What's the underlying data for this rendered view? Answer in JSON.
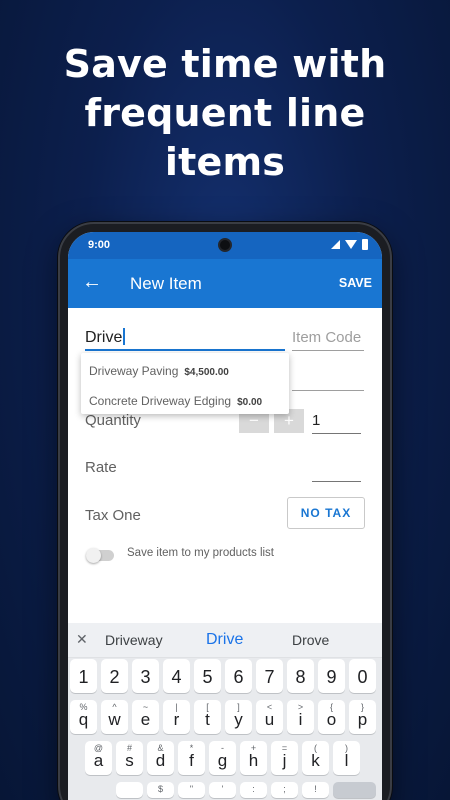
{
  "headline": "Save time with frequent line items",
  "status_bar": {
    "time": "9:00"
  },
  "app_bar": {
    "title": "New Item",
    "save_label": "SAVE",
    "back_icon": "arrow-left-icon"
  },
  "form": {
    "item_name_value": "Drive",
    "item_code_placeholder": "Item Code",
    "suggestions": [
      {
        "name": "Driveway Paving",
        "price": "$4,500.00"
      },
      {
        "name": "Concrete Driveway Edging",
        "price": "$0.00"
      }
    ],
    "quantity_label": "Quantity",
    "quantity_value": "1",
    "minus_label": "−",
    "plus_label": "+",
    "rate_label": "Rate",
    "tax_label": "Tax One",
    "tax_button_label": "NO TAX",
    "save_toggle_label": "Save item to my products list"
  },
  "keyboard": {
    "suggestions": [
      "Driveway",
      "Drive",
      "Drove"
    ],
    "number_row": [
      "1",
      "2",
      "3",
      "4",
      "5",
      "6",
      "7",
      "8",
      "9",
      "0"
    ],
    "row1": {
      "keys": [
        "q",
        "w",
        "e",
        "r",
        "t",
        "y",
        "u",
        "i",
        "o",
        "p"
      ],
      "alts": [
        "%",
        "^",
        "~",
        "|",
        "[",
        "]",
        "<",
        ">",
        "{",
        "}"
      ]
    },
    "row2": {
      "keys": [
        "a",
        "s",
        "d",
        "f",
        "g",
        "h",
        "j",
        "k",
        "l"
      ],
      "alts": [
        "@",
        "#",
        "&",
        "*",
        "-",
        "+",
        "=",
        "(",
        ")"
      ]
    },
    "row3_alts": [
      "$",
      "\"",
      "'",
      ":",
      ";",
      "!"
    ]
  },
  "colors": {
    "primary": "#1976d2",
    "status_bar": "#1565c0",
    "background": "#0c1f4d"
  }
}
